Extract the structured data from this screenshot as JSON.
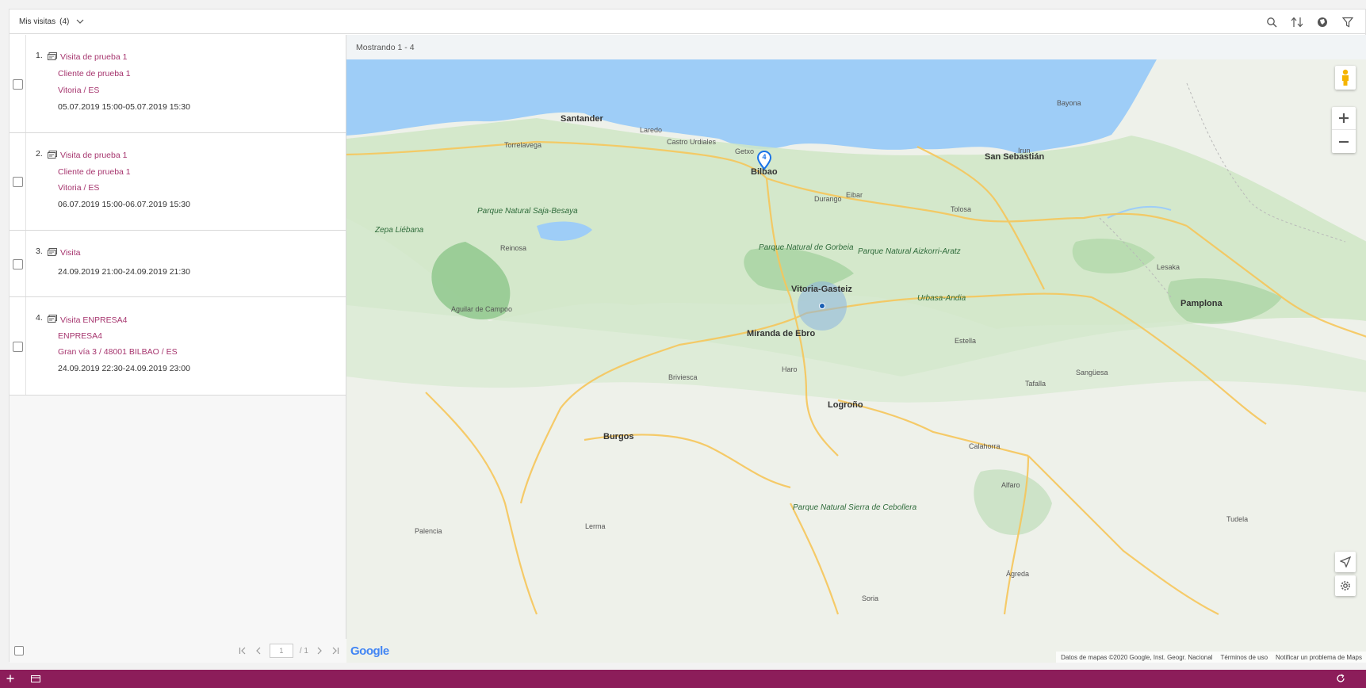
{
  "header": {
    "title": "Mis visitas",
    "count": "(4)"
  },
  "list": {
    "items": [
      {
        "number": "1.",
        "title": "Visita de prueba 1",
        "client": "Cliente de prueba 1",
        "location": "Vitoria / ES",
        "datetime": "05.07.2019 15:00-05.07.2019 15:30"
      },
      {
        "number": "2.",
        "title": "Visita de prueba 1",
        "client": "Cliente de prueba 1",
        "location": "Vitoria / ES",
        "datetime": "06.07.2019 15:00-06.07.2019 15:30"
      },
      {
        "number": "3.",
        "title": "Visita",
        "datetime": "24.09.2019 21:00-24.09.2019 21:30"
      },
      {
        "number": "4.",
        "title": "Visita ENPRESA4",
        "client": "ENPRESA4",
        "location": "Gran vía 3 / 48001 BILBAO / ES",
        "datetime": "24.09.2019 22:30-24.09.2019 23:00"
      }
    ]
  },
  "pager": {
    "page": "1",
    "total": "/ 1"
  },
  "map": {
    "showing": "Mostrando 1 - 4",
    "marker_count": "4",
    "logo": "Google",
    "attribution": [
      "Datos de mapas ©2020 Google, Inst. Geogr. Nacional",
      "Términos de uso",
      "Notificar un problema de Maps"
    ],
    "places": [
      {
        "name": "Santander"
      },
      {
        "name": "Bilbao"
      },
      {
        "name": "San Sebastián"
      },
      {
        "name": "Vitoria-Gasteiz"
      },
      {
        "name": "Pamplona"
      },
      {
        "name": "Logroño"
      },
      {
        "name": "Burgos"
      },
      {
        "name": "Bayona"
      },
      {
        "name": "Torrelavega"
      },
      {
        "name": "Miranda de Ebro"
      },
      {
        "name": "Estella"
      },
      {
        "name": "Tudela"
      },
      {
        "name": "Palencia"
      },
      {
        "name": "Soria"
      },
      {
        "name": "Calahorra"
      },
      {
        "name": "Laredo"
      },
      {
        "name": "Castro Urdiales"
      },
      {
        "name": "Getxo"
      },
      {
        "name": "Durango"
      },
      {
        "name": "Eibar"
      },
      {
        "name": "Tolosa"
      },
      {
        "name": "Irun"
      },
      {
        "name": "Haro"
      },
      {
        "name": "Aguilar de Campoo"
      },
      {
        "name": "Reinosa"
      },
      {
        "name": "Briviesca"
      },
      {
        "name": "Lerma"
      },
      {
        "name": "Tafalla"
      },
      {
        "name": "Alfaro"
      },
      {
        "name": "Ágreda"
      },
      {
        "name": "Sangüesa"
      },
      {
        "name": "Lesaka"
      }
    ],
    "parks": [
      {
        "name": "Parque Natural Saja-Besaya"
      },
      {
        "name": "Parque Natural de Gorbeia"
      },
      {
        "name": "Parque Natural Aizkorri-Aratz"
      },
      {
        "name": "Urbasa-Andia"
      },
      {
        "name": "Parque Natural Sierra de Cebollera"
      },
      {
        "name": "Zepa Liébana"
      }
    ]
  },
  "colors": {
    "accent": "#a6356e",
    "bottombar": "#8c1d5a",
    "sea": "#9ecdf7",
    "land": "#e6efe0",
    "marker": "#1a73e8"
  }
}
